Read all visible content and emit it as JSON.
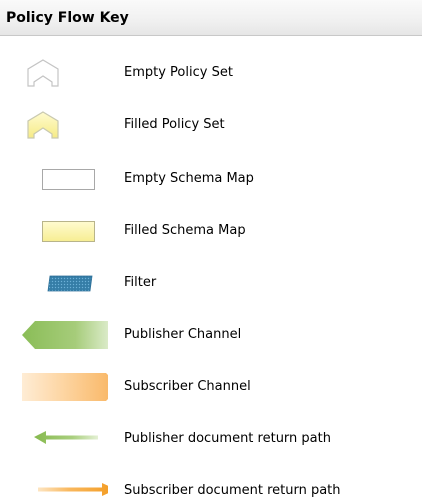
{
  "header": {
    "title": "Policy Flow Key"
  },
  "legend": {
    "items": [
      {
        "label": "Empty Policy Set",
        "icon": "empty-policy-set-icon"
      },
      {
        "label": "Filled Policy Set",
        "icon": "filled-policy-set-icon"
      },
      {
        "label": "Empty Schema Map",
        "icon": "empty-schema-map-icon"
      },
      {
        "label": "Filled Schema Map",
        "icon": "filled-schema-map-icon"
      },
      {
        "label": "Filter",
        "icon": "filter-icon"
      },
      {
        "label": "Publisher Channel",
        "icon": "publisher-channel-icon"
      },
      {
        "label": "Subscriber Channel",
        "icon": "subscriber-channel-icon"
      },
      {
        "label": "Publisher document return path",
        "icon": "publisher-return-arrow-icon"
      },
      {
        "label": "Subscriber document return path",
        "icon": "subscriber-return-arrow-icon"
      }
    ]
  },
  "colors": {
    "policy_fill": "#fbf3a0",
    "policy_stroke": "#c8c8c8",
    "filter_fill": "#3b86b0",
    "publisher_green": "#8cbf5a",
    "subscriber_orange": "#f7a23a"
  }
}
